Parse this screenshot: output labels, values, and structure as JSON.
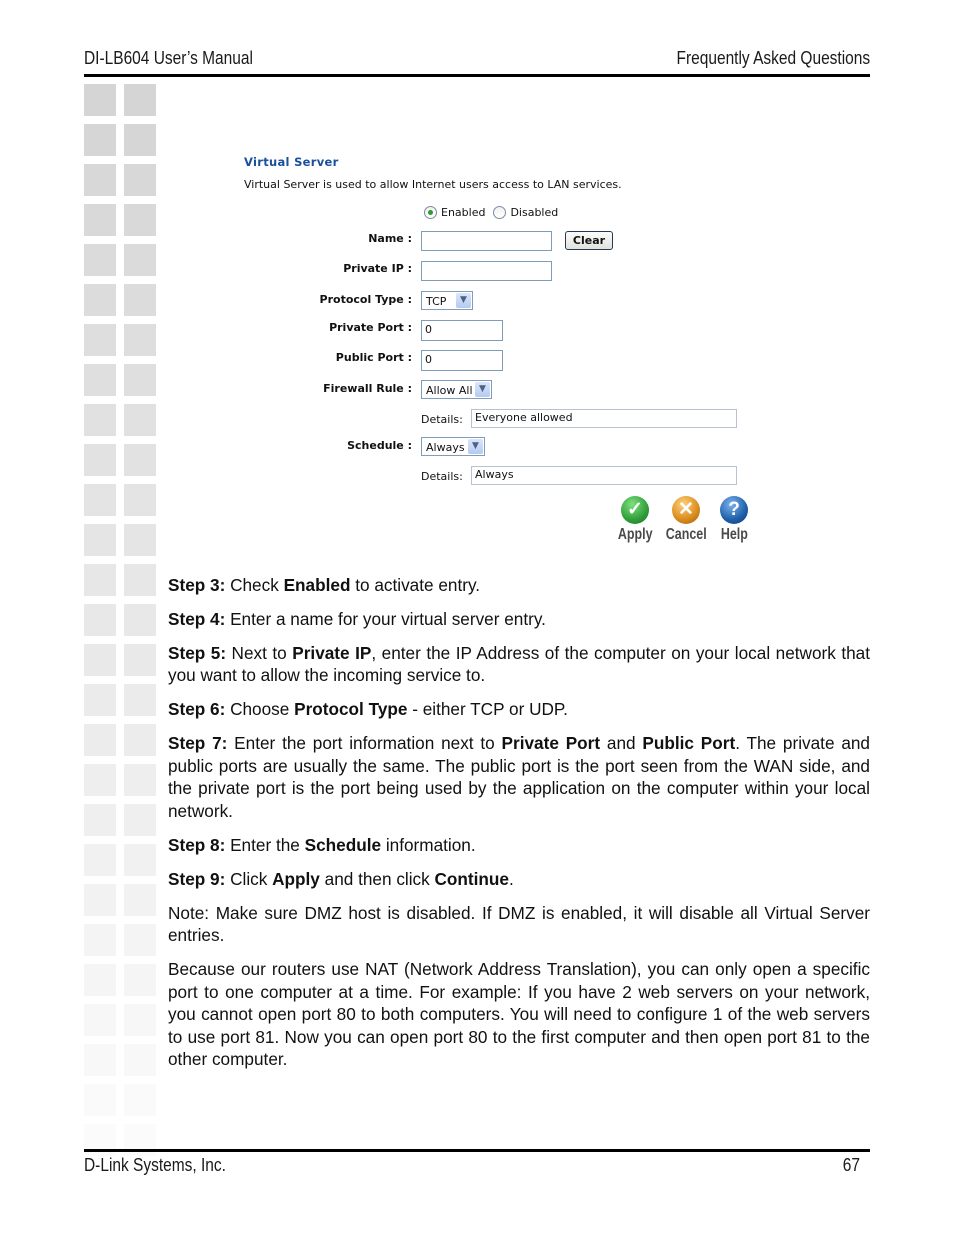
{
  "page_header": {
    "left": "DI-LB604 User’s Manual",
    "right": "Frequently Asked Questions"
  },
  "page_footer": {
    "left": "D-Link Systems, Inc.",
    "page_number": "67"
  },
  "virtual_server": {
    "title": "Virtual Server",
    "description": "Virtual Server is used to allow Internet users access to LAN services.",
    "status": {
      "enabled_label": "Enabled",
      "disabled_label": "Disabled",
      "selected": "Enabled"
    },
    "fields": {
      "name": {
        "label": "Name :",
        "value": ""
      },
      "clear_button": "Clear",
      "private_ip": {
        "label": "Private IP :",
        "value": ""
      },
      "protocol_type": {
        "label": "Protocol Type :",
        "value": "TCP"
      },
      "private_port": {
        "label": "Private Port :",
        "value": "0"
      },
      "public_port": {
        "label": "Public Port :",
        "value": "0"
      },
      "firewall_rule": {
        "label": "Firewall Rule :",
        "value": "Allow All",
        "details_label": "Details:",
        "details_value": "Everyone allowed"
      },
      "schedule": {
        "label": "Schedule :",
        "value": "Always",
        "details_label": "Details:",
        "details_value": "Always"
      }
    },
    "actions": {
      "apply": {
        "label": "Apply",
        "icon": "checkmark-icon",
        "color": "#2f9e3a"
      },
      "cancel": {
        "label": "Cancel",
        "icon": "x-icon",
        "color": "#d98a1c"
      },
      "help": {
        "label": "Help",
        "icon": "question-icon",
        "color": "#1e5fa8"
      }
    }
  },
  "steps": [
    {
      "label": "Step 3:",
      "parts": [
        {
          "t": " Check "
        },
        {
          "b": "Enabled"
        },
        {
          "t": " to activate entry."
        }
      ]
    },
    {
      "label": "Step 4:",
      "parts": [
        {
          "t": " Enter a name for your virtual server entry."
        }
      ]
    },
    {
      "label": "Step 5:",
      "parts": [
        {
          "t": " Next to "
        },
        {
          "b": "Private IP"
        },
        {
          "t": ", enter the IP Address of the computer on your local network that you want to allow the incoming service to."
        }
      ]
    },
    {
      "label": "Step 6:",
      "parts": [
        {
          "t": " Choose "
        },
        {
          "b": "Protocol Type"
        },
        {
          "t": " - either TCP or UDP."
        }
      ]
    },
    {
      "label": "Step 7:",
      "parts": [
        {
          "t": " Enter the port information next to "
        },
        {
          "b": "Private Port"
        },
        {
          "t": " and "
        },
        {
          "b": "Public Port"
        },
        {
          "t": ". The private and public ports are usually the same. The public port is the port seen from the WAN side, and the private port is the port being used by the application on the computer within your local network."
        }
      ]
    },
    {
      "label": "Step 8:",
      "parts": [
        {
          "t": " Enter the "
        },
        {
          "b": "Schedule"
        },
        {
          "t": " information."
        }
      ]
    },
    {
      "label": "Step 9:",
      "parts": [
        {
          "t": " Click "
        },
        {
          "b": "Apply"
        },
        {
          "t": " and then click "
        },
        {
          "b": "Continue"
        },
        {
          "t": "."
        }
      ]
    }
  ],
  "note": "Note: Make sure DMZ host is disabled. If DMZ is enabled, it will disable all Virtual Server entries.",
  "nat_paragraph": "Because our routers use NAT (Network Address Translation), you can only open a specific port to one computer at a time. For example: If you have 2 web servers on your network, you cannot open port 80 to both computers. You will need to configure 1 of the web servers to use port 81. Now you can open port 80 to the first computer and then open port 81 to the other computer."
}
